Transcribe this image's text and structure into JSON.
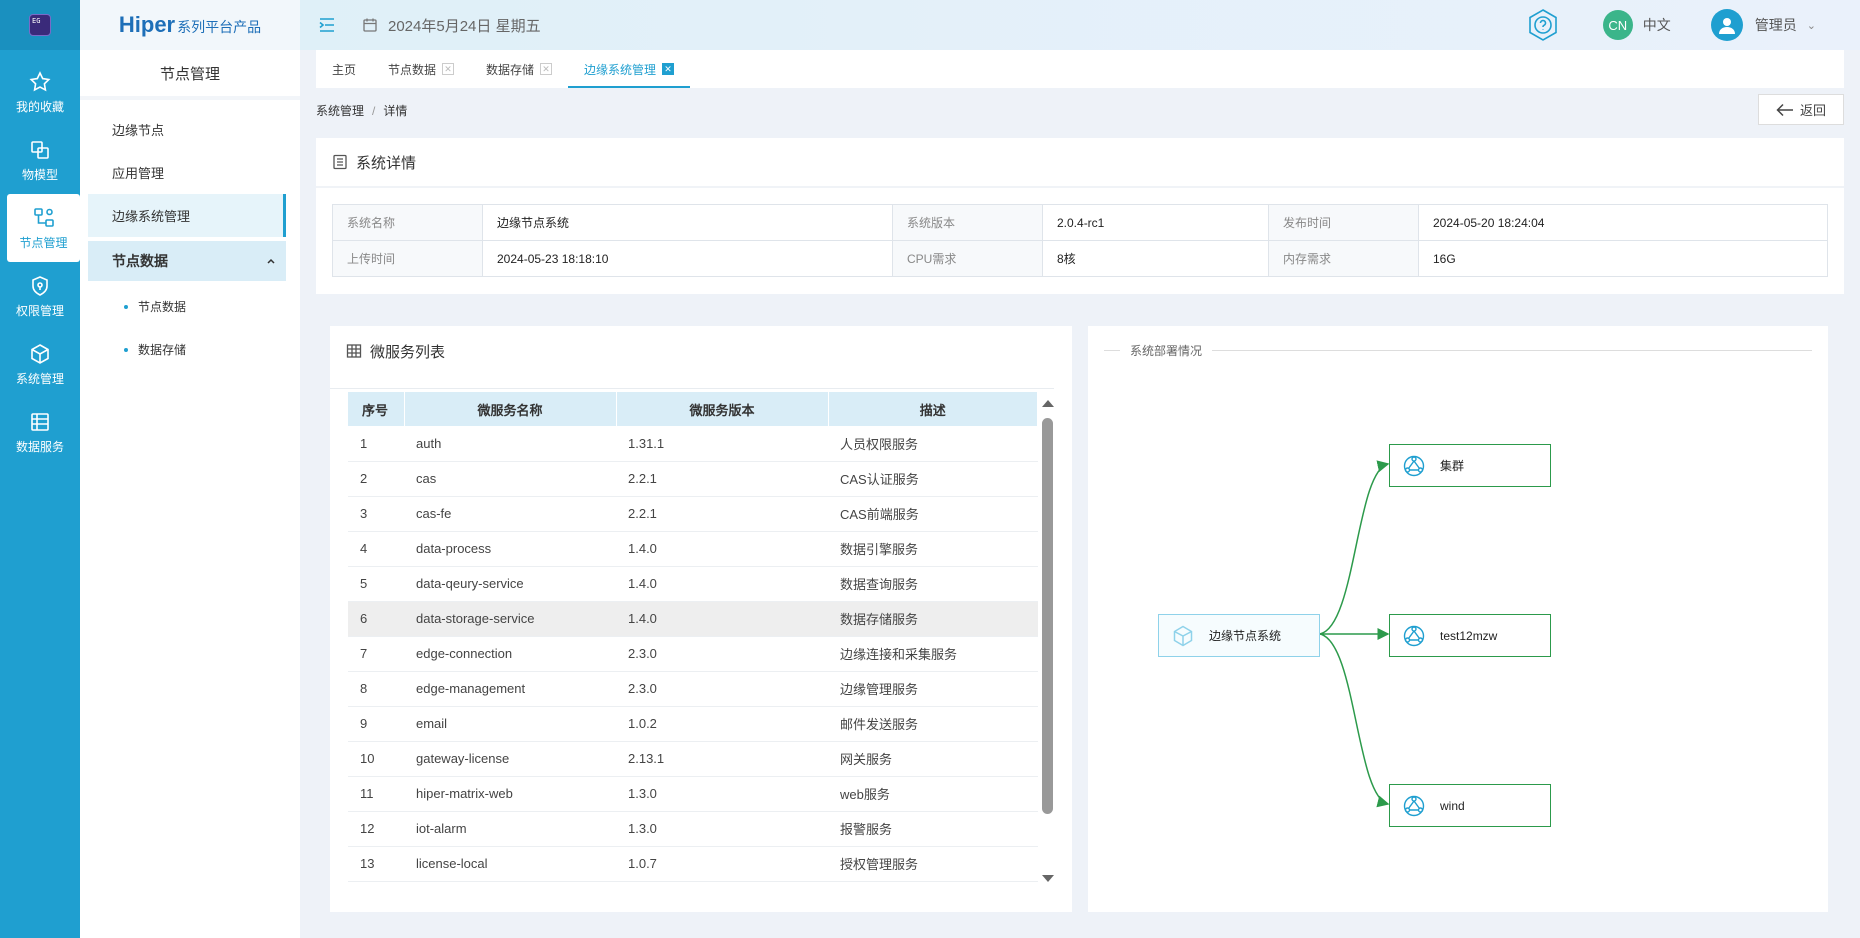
{
  "rail": {
    "logo": "EG",
    "items": [
      {
        "label": "我的收藏",
        "icon": "star-icon"
      },
      {
        "label": "物模型",
        "icon": "model-icon"
      },
      {
        "label": "节点管理",
        "icon": "node-icon"
      },
      {
        "label": "权限管理",
        "icon": "shield-icon"
      },
      {
        "label": "系统管理",
        "icon": "cube-icon"
      },
      {
        "label": "数据服务",
        "icon": "data-icon"
      }
    ]
  },
  "brand": {
    "name": "Hiper",
    "suffix": "系列平台产品"
  },
  "sidebar": {
    "title": "节点管理",
    "items": [
      {
        "label": "边缘节点"
      },
      {
        "label": "应用管理"
      },
      {
        "label": "边缘系统管理"
      }
    ],
    "group": {
      "label": "节点数据",
      "children": [
        {
          "label": "节点数据"
        },
        {
          "label": "数据存储"
        }
      ]
    }
  },
  "header": {
    "date": "2024年5月24日 星期五",
    "lang_badge": "CN",
    "lang_label": "中文",
    "user": "管理员"
  },
  "tabs": [
    {
      "label": "主页"
    },
    {
      "label": "节点数据"
    },
    {
      "label": "数据存储"
    },
    {
      "label": "边缘系统管理"
    }
  ],
  "breadcrumb": {
    "parent": "系统管理",
    "sep": "/",
    "current": "详情"
  },
  "back_label": "返回",
  "detail": {
    "title": "系统详情",
    "rows": [
      [
        {
          "label": "系统名称",
          "value": "边缘节点系统"
        },
        {
          "label": "系统版本",
          "value": "2.0.4-rc1"
        },
        {
          "label": "发布时间",
          "value": "2024-05-20 18:24:04"
        }
      ],
      [
        {
          "label": "上传时间",
          "value": "2024-05-23 18:18:10"
        },
        {
          "label": "CPU需求",
          "value": "8核"
        },
        {
          "label": "内存需求",
          "value": "16G"
        }
      ]
    ]
  },
  "microservices": {
    "title": "微服务列表",
    "columns": [
      "序号",
      "微服务名称",
      "微服务版本",
      "描述"
    ],
    "rows": [
      [
        "1",
        "auth",
        "1.31.1",
        "人员权限服务"
      ],
      [
        "2",
        "cas",
        "2.2.1",
        "CAS认证服务"
      ],
      [
        "3",
        "cas-fe",
        "2.2.1",
        "CAS前端服务"
      ],
      [
        "4",
        "data-process",
        "1.4.0",
        "数据引擎服务"
      ],
      [
        "5",
        "data-qeury-service",
        "1.4.0",
        "数据查询服务"
      ],
      [
        "6",
        "data-storage-service",
        "1.4.0",
        "数据存储服务"
      ],
      [
        "7",
        "edge-connection",
        "2.3.0",
        "边缘连接和采集服务"
      ],
      [
        "8",
        "edge-management",
        "2.3.0",
        "边缘管理服务"
      ],
      [
        "9",
        "email",
        "1.0.2",
        "邮件发送服务"
      ],
      [
        "10",
        "gateway-license",
        "2.13.1",
        "网关服务"
      ],
      [
        "11",
        "hiper-matrix-web",
        "1.3.0",
        "web服务"
      ],
      [
        "12",
        "iot-alarm",
        "1.3.0",
        "报警服务"
      ],
      [
        "13",
        "license-local",
        "1.0.7",
        "授权管理服务"
      ]
    ]
  },
  "deployment": {
    "title": "系统部署情况",
    "source": "边缘节点系统",
    "targets": [
      "集群",
      "test12mzw",
      "wind"
    ]
  },
  "colors": {
    "accent": "#1f9fd0",
    "edge": "#2c9a4b"
  }
}
